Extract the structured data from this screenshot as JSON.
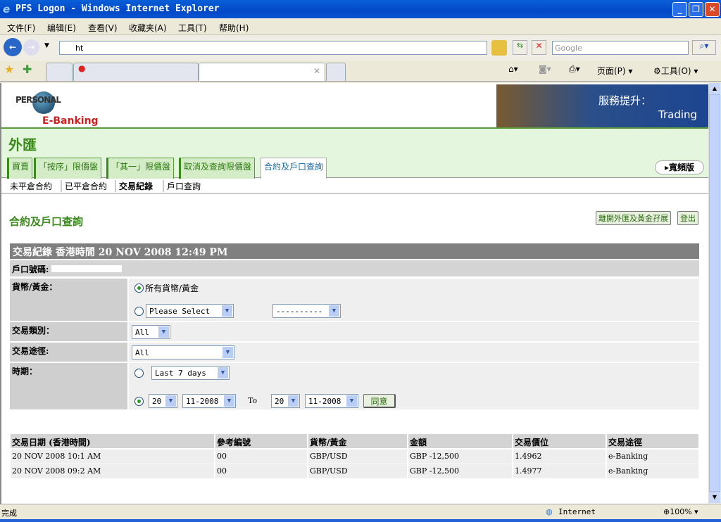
{
  "window": {
    "title": "PFS Logon - Windows Internet Explorer"
  },
  "menu": [
    "文件(F)",
    "编辑(E)",
    "查看(V)",
    "收藏夹(A)",
    "工具(T)",
    "帮助(H)"
  ],
  "address": {
    "url": "ht"
  },
  "search": {
    "placeholder": "Google"
  },
  "toolbar": {
    "page": "页面(P)",
    "tools": "工具(O)"
  },
  "banner": {
    "line1": "服務提升：",
    "line2": "Trading",
    "logo_text": "PERSONAL E-Banking"
  },
  "page": {
    "title": "外匯",
    "broadband": "▸寬頻版",
    "heading": "合約及戶口查詢",
    "leave_btn": "離開外匯及黃金孖展",
    "logout_btn": "登出"
  },
  "tabs": [
    "買賣",
    "「按序」限價盤",
    "「其一」限價盤",
    "取消及查詢限價盤",
    "合約及戶口查詢"
  ],
  "subnav": [
    "未平倉合約",
    "已平倉合約",
    "交易紀錄",
    "戶口查詢"
  ],
  "form": {
    "header": "交易紀錄  香港時間 20 NOV 2008 12:49 PM",
    "account_label": "戶口號碼:",
    "currency_label": "貨幣/黃金：",
    "all_currency": "所有貨幣/黃金",
    "currency_select": "Please Select",
    "currency_select2": "----------",
    "type_label": "交易類別：",
    "type_value": "All",
    "channel_label": "交易途徑:",
    "channel_value": "All",
    "period_label": "時期：",
    "period_preset": "Last 7 days",
    "from_day": "20",
    "from_month": "11-2008",
    "to_label": "To",
    "to_day": "20",
    "to_month": "11-2008",
    "submit": "同意"
  },
  "results": {
    "headers": [
      "交易日期 (香港時間)",
      "參考編號",
      "貨幣/黃金",
      "金額",
      "交易價位",
      "交易途徑"
    ],
    "rows": [
      [
        "20 NOV 2008 10:1  AM",
        "00",
        "GBP/USD",
        "GBP -12,500",
        "1.4962",
        "e-Banking"
      ],
      [
        "20 NOV 2008 09:2  AM",
        "00",
        "GBP/USD",
        "GBP -12,500",
        "1.4977",
        "e-Banking"
      ]
    ]
  },
  "status": {
    "text": "完成",
    "zone": "Internet",
    "zoom": "100%"
  }
}
